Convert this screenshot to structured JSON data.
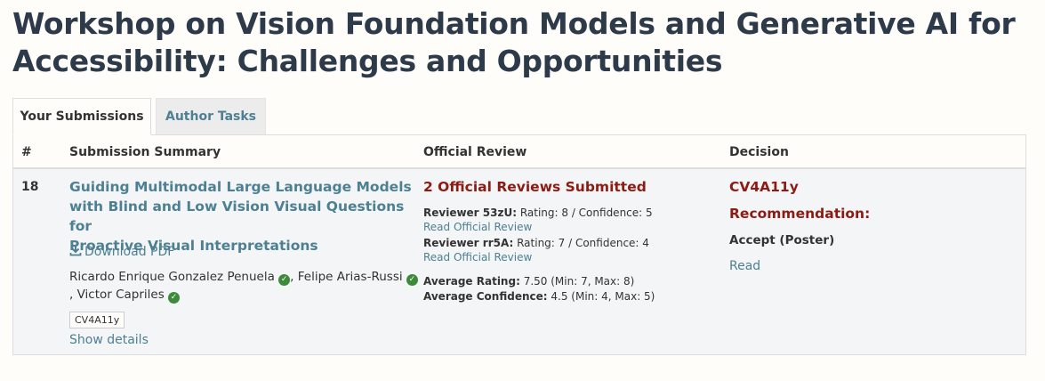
{
  "page": {
    "title_line1": "Workshop on Vision Foundation Models and Generative AI for",
    "title_line2": "Accessibility: Challenges and Opportunities"
  },
  "tabs": [
    {
      "label": "Your Submissions",
      "active": true
    },
    {
      "label": "Author Tasks",
      "active": false
    }
  ],
  "table": {
    "headers": {
      "number": "#",
      "summary": "Submission Summary",
      "review": "Official Review",
      "decision": "Decision"
    },
    "rows": [
      {
        "number": "18",
        "title_line1": "Guiding Multimodal Large Language Models",
        "title_line2": "with Blind and Low Vision Visual Questions for",
        "title_line3": "Proactive Visual Interpretations",
        "download_label": "Download PDF",
        "authors": {
          "author1": "Ricardo Enrique Gonzalez Penuela",
          "author2": "Felipe Arias-Russi",
          "separator1": ",",
          "separator2": ",",
          "author3": "Victor Capriles"
        },
        "badge": "CV4A11y",
        "show_details": "Show details",
        "review": {
          "summary": "2 Official Reviews Submitted",
          "reviewers": [
            {
              "name": "Reviewer 53zU:",
              "detail": "Rating: 8 / Confidence: 5",
              "link": "Read Official Review"
            },
            {
              "name": "Reviewer rr5A:",
              "detail": "Rating: 7 / Confidence: 4",
              "link": "Read Official Review"
            }
          ],
          "avg_rating_label": "Average Rating:",
          "avg_rating_value": "7.50 (Min: 7, Max: 8)",
          "avg_conf_label": "Average Confidence:",
          "avg_conf_value": "4.5 (Min: 4, Max: 5)"
        },
        "decision": {
          "venue": "CV4A11y",
          "recommendation_label": "Recommendation:",
          "value": "Accept (Poster)",
          "read_label": "Read"
        }
      }
    ]
  },
  "colors": {
    "title": "#2c3a4a",
    "link": "#4d8093",
    "accent_red": "#8c1b13",
    "verified_green": "#3c8a3a",
    "row_bg": "#f4f5f6"
  },
  "icons": {
    "download": "download-icon",
    "verified": "verified-check-icon"
  }
}
